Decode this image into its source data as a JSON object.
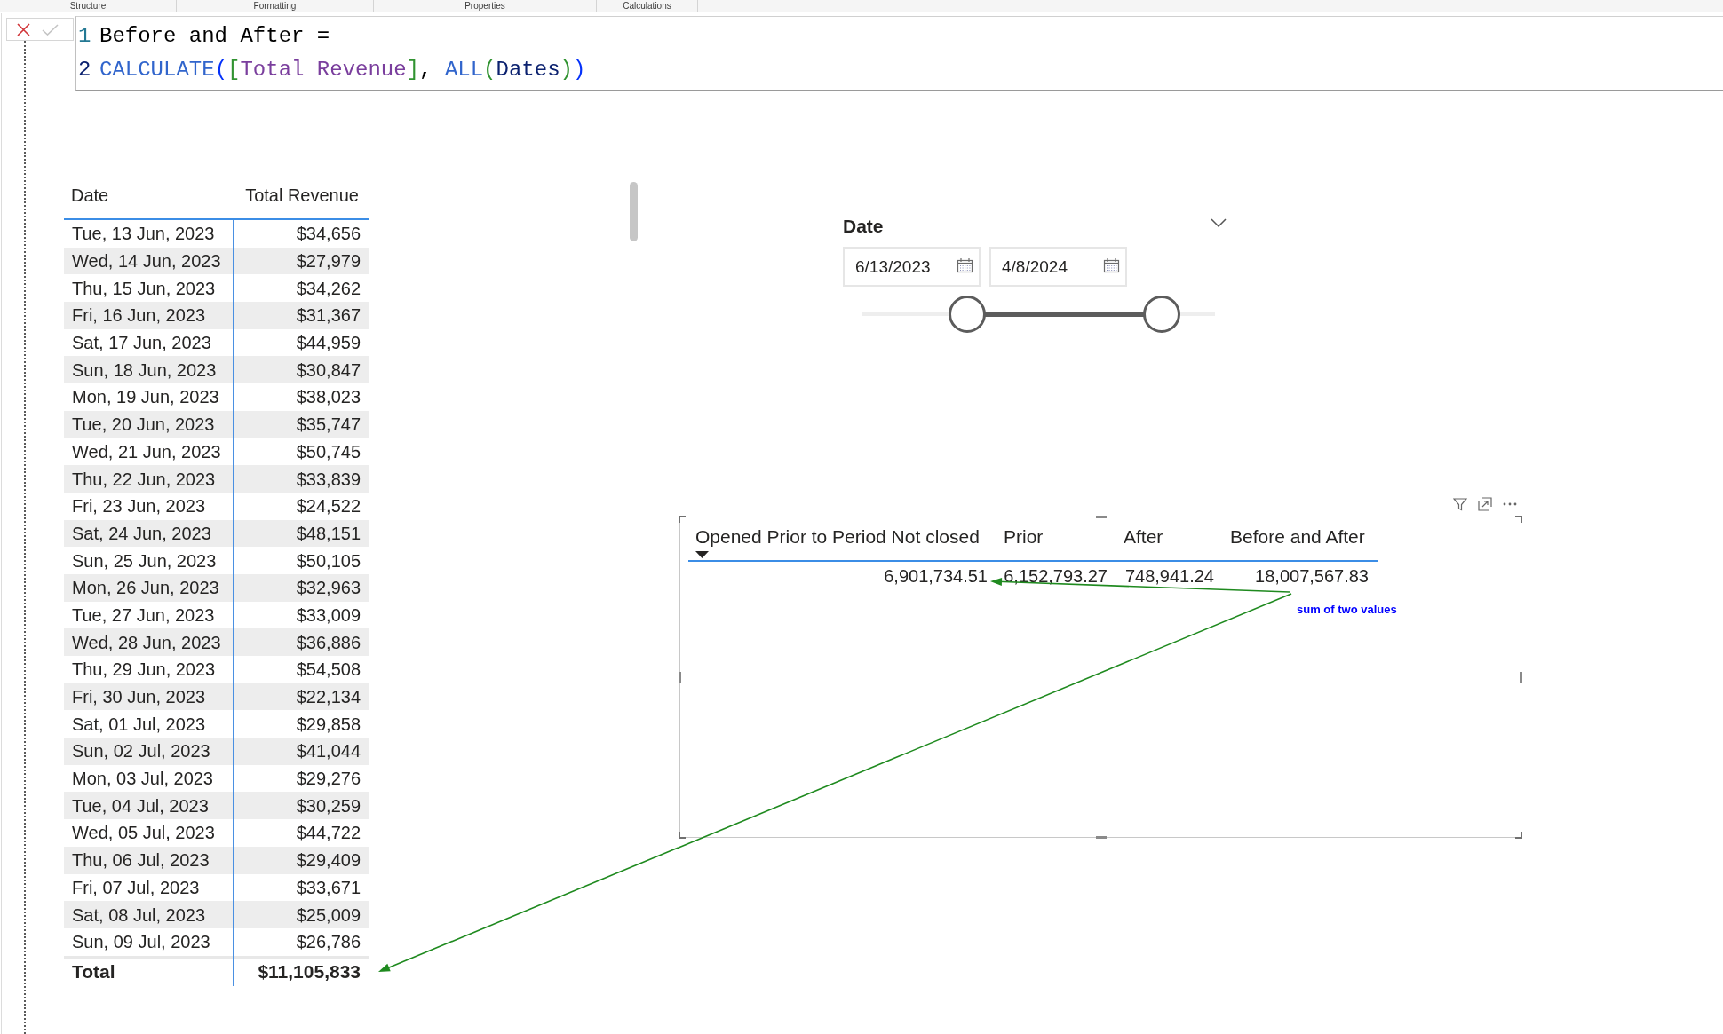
{
  "ribbon_groups": [
    {
      "label": "Structure"
    },
    {
      "label": "Formatting"
    },
    {
      "label": "Properties"
    },
    {
      "label": "Calculations"
    }
  ],
  "formula_bar": {
    "buttons": [
      {
        "kind": "cancel",
        "disabled": false
      },
      {
        "kind": "commit",
        "disabled": true
      }
    ],
    "lines": [
      {
        "number": "1",
        "active": false,
        "tokens": [
          {
            "text": "Before and After =",
            "kind": "plain"
          }
        ]
      },
      {
        "number": "2",
        "active": true,
        "tokens": [
          {
            "text": "CALCULATE",
            "kind": "function"
          },
          {
            "text": "(",
            "kind": "bracket1"
          },
          {
            "text": "[",
            "kind": "bracket2"
          },
          {
            "text": "Total Revenue",
            "kind": "measure"
          },
          {
            "text": "]",
            "kind": "bracket2"
          },
          {
            "text": ", ",
            "kind": "plain"
          },
          {
            "text": "ALL",
            "kind": "function"
          },
          {
            "text": "(",
            "kind": "bracket2"
          },
          {
            "text": "Dates",
            "kind": "table"
          },
          {
            "text": ")",
            "kind": "bracket2"
          },
          {
            "text": ")",
            "kind": "bracket1"
          }
        ]
      }
    ]
  },
  "table": {
    "columns": [
      "Date",
      "Total Revenue"
    ],
    "rows": [
      [
        "Tue, 13 Jun, 2023",
        "$34,656"
      ],
      [
        "Wed, 14 Jun, 2023",
        "$27,979"
      ],
      [
        "Thu, 15 Jun, 2023",
        "$34,262"
      ],
      [
        "Fri, 16 Jun, 2023",
        "$31,367"
      ],
      [
        "Sat, 17 Jun, 2023",
        "$44,959"
      ],
      [
        "Sun, 18 Jun, 2023",
        "$30,847"
      ],
      [
        "Mon, 19 Jun, 2023",
        "$38,023"
      ],
      [
        "Tue, 20 Jun, 2023",
        "$35,747"
      ],
      [
        "Wed, 21 Jun, 2023",
        "$50,745"
      ],
      [
        "Thu, 22 Jun, 2023",
        "$33,839"
      ],
      [
        "Fri, 23 Jun, 2023",
        "$24,522"
      ],
      [
        "Sat, 24 Jun, 2023",
        "$48,151"
      ],
      [
        "Sun, 25 Jun, 2023",
        "$50,105"
      ],
      [
        "Mon, 26 Jun, 2023",
        "$32,963"
      ],
      [
        "Tue, 27 Jun, 2023",
        "$33,009"
      ],
      [
        "Wed, 28 Jun, 2023",
        "$36,886"
      ],
      [
        "Thu, 29 Jun, 2023",
        "$54,508"
      ],
      [
        "Fri, 30 Jun, 2023",
        "$22,134"
      ],
      [
        "Sat, 01 Jul, 2023",
        "$29,858"
      ],
      [
        "Sun, 02 Jul, 2023",
        "$41,044"
      ],
      [
        "Mon, 03 Jul, 2023",
        "$29,276"
      ],
      [
        "Tue, 04 Jul, 2023",
        "$30,259"
      ],
      [
        "Wed, 05 Jul, 2023",
        "$44,722"
      ],
      [
        "Thu, 06 Jul, 2023",
        "$29,409"
      ],
      [
        "Fri, 07 Jul, 2023",
        "$33,671"
      ],
      [
        "Sat, 08 Jul, 2023",
        "$25,009"
      ],
      [
        "Sun, 09 Jul, 2023",
        "$26,786"
      ]
    ],
    "total": [
      "Total",
      "$11,105,833"
    ]
  },
  "slicer": {
    "title": "Date",
    "start_date": {
      "value": "6/13/2023"
    },
    "end_date": {
      "value": "4/8/2024"
    },
    "thumbs": [
      {
        "level": 0.3
      },
      {
        "level": 0.85
      }
    ]
  },
  "matrix": {
    "columns": [
      {
        "label": "Opened Prior to Period Not closed",
        "sorted": true
      },
      {
        "label": "Prior",
        "sorted": false
      },
      {
        "label": "After",
        "sorted": false
      },
      {
        "label": "Before and After",
        "sorted": false
      }
    ],
    "values": [
      "6,901,734.51",
      "6,152,793.27",
      "748,941.24",
      "18,007,567.83"
    ]
  },
  "annotation": {
    "text": "sum of two values"
  }
}
